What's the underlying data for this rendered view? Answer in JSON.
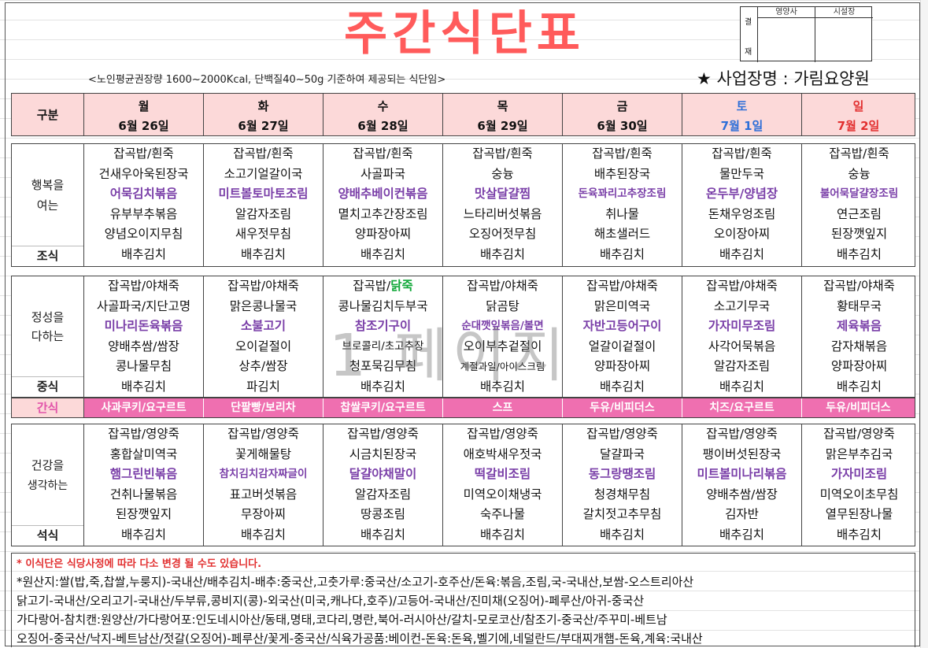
{
  "title": "주간식단표",
  "approval": {
    "side_label": [
      "결",
      "재"
    ],
    "col1": "영양사",
    "col2": "시설장"
  },
  "subnote": "<노인평균권장량 1600~2000Kcal, 단백질40~50g 기준하여 제공되는 식단임>",
  "business": "★ 사업장명 : 가림요양원",
  "header": {
    "category": "구분",
    "days": [
      {
        "day": "월",
        "date": "6월 26일"
      },
      {
        "day": "화",
        "date": "6월 27일"
      },
      {
        "day": "수",
        "date": "6월 28일"
      },
      {
        "day": "목",
        "date": "6월 29일"
      },
      {
        "day": "금",
        "date": "6월 30일"
      },
      {
        "day": "토",
        "date": "7월 1일"
      },
      {
        "day": "일",
        "date": "7월 2일"
      }
    ]
  },
  "colors": {
    "header_bg": "#fcd9d9",
    "title": "#ff5b5b",
    "highlight": "#7a3fa8",
    "snack_bg": "#ef6fb0",
    "saturday": "#2e6fd8",
    "sunday": "#e23030"
  },
  "breakfast": {
    "label_main": [
      "행복을",
      "여는"
    ],
    "label_meal": "조식",
    "cols": [
      [
        "잡곡밥/흰죽",
        "건새우아욱된장국",
        "어묵김치볶음",
        "유부부추볶음",
        "양념오이지무침",
        "배추김치"
      ],
      [
        "잡곡밥/흰죽",
        "소고기얼갈이국",
        "미트볼토마토조림",
        "알감자조림",
        "새우젓무침",
        "배추김치"
      ],
      [
        "잡곡밥/흰죽",
        "사골파국",
        "양배추베이컨볶음",
        "멸치고추간장조림",
        "양파장아찌",
        "배추김치"
      ],
      [
        "잡곡밥/흰죽",
        "숭늉",
        "맛살달걀찜",
        "느타리버섯볶음",
        "오징어젓무침",
        "배추김치"
      ],
      [
        "잡곡밥/흰죽",
        "배추된장국",
        "돈육꽈리고추장조림",
        "취나물",
        "해초샐러드",
        "배추김치"
      ],
      [
        "잡곡밥/흰죽",
        "물만두국",
        "온두부/양념장",
        "돈채우엉조림",
        "오이장아찌",
        "배추김치"
      ],
      [
        "잡곡밥/흰죽",
        "숭늉",
        "불어묵달걀장조림",
        "연근조림",
        "된장깻잎지",
        "배추김치"
      ]
    ]
  },
  "lunch": {
    "label_main": [
      "정성을",
      "다하는"
    ],
    "label_meal": "중식",
    "cols": [
      [
        "잡곡밥/야채죽",
        "사골파국/지단고명",
        "미나리돈육볶음",
        "양배추쌈/쌈장",
        "콩나물무침",
        "배추김치"
      ],
      [
        "잡곡밥/야채죽",
        "맑은콩나물국",
        "소불고기",
        "오이겉절이",
        "상추/쌈장",
        "파김치"
      ],
      [
        "잡곡밥/닭죽",
        "콩나물김치두부국",
        "참조기구이",
        "브로콜리/초고추장",
        "청포묵김무침",
        "배추김치"
      ],
      [
        "잡곡밥/야채죽",
        "닭곰탕",
        "순대깻잎볶음/볼면",
        "오이부추겉절이",
        "계절과일/아이스크림",
        "배추김치"
      ],
      [
        "잡곡밥/야채죽",
        "맑은미역국",
        "자반고등어구이",
        "얼갈이겉절이",
        "양파장아찌",
        "배추김치"
      ],
      [
        "잡곡밥/야채죽",
        "소고기무국",
        "가자미무조림",
        "사각어묵볶음",
        "알감자조림",
        "배추김치"
      ],
      [
        "잡곡밥/야채죽",
        "황태무국",
        "제육볶음",
        "감자채볶음",
        "양파장아찌",
        "배추김치"
      ]
    ]
  },
  "snack": {
    "label": "간식",
    "items": [
      "사과쿠키/요구르트",
      "단팥빵/보리차",
      "찹쌀쿠키/요구르트",
      "스프",
      "두유/비피더스",
      "치즈/요구르트",
      "두유/비피더스"
    ]
  },
  "dinner": {
    "label_main": [
      "건강을",
      "생각하는"
    ],
    "label_meal": "석식",
    "cols": [
      [
        "잡곡밥/영양죽",
        "홍합살미역국",
        "햄그린빈볶음",
        "건취나물볶음",
        "된장깻잎지",
        "배추김치"
      ],
      [
        "잡곡밥/영양죽",
        "꽃게해물탕",
        "참치김치감자짜글이",
        "표고버섯볶음",
        "무장아찌",
        "배추김치"
      ],
      [
        "잡곡밥/영양죽",
        "시금치된장국",
        "달걀야채말이",
        "알감자조림",
        "땅콩조림",
        "배추김치"
      ],
      [
        "잡곡밥/영양죽",
        "애호박새우젓국",
        "떡갈비조림",
        "미역오이채냉국",
        "숙주나물",
        "배추김치"
      ],
      [
        "잡곡밥/영양죽",
        "달걀파국",
        "동그랑땡조림",
        "청경채무침",
        "갈치젓고추무침",
        "배추김치"
      ],
      [
        "잡곡밥/영양죽",
        "팽이버섯된장국",
        "미트볼미나리볶음",
        "양배추쌈/쌈장",
        "김자반",
        "배추김치"
      ],
      [
        "잡곡밥/영양죽",
        "맑은부추김국",
        "가자미조림",
        "미역오이초무침",
        "열무된장나물",
        "배추김치"
      ]
    ]
  },
  "notes": {
    "warning": "* 이식단은  식당사정에 따라 다소 변경 될 수도 있습니다.",
    "lines": [
      "*원산지:쌀(밥,죽,찹쌀,누룽지)-국내산/배추김치-배추:중국산,고춧가루:중국산/소고기-호주산/돈육:볶음,조림,국-국내산,보쌈-오스트리아산",
      "닭고기-국내산/오리고기-국내산/두부류,콩비지(콩)-외국산(미국,캐나다,호주)/고등어-국내산/진미채(오징어)-페루산/아귀-중국산",
      "가다랑어-참치캔:원양산/가다랑어포:인도네시아산/동태,명태,코다리,명란,북어-러시아산/갈치-모로코산/참조기-중국산/주꾸미-베트남",
      "오징어-중국산/낙지-베트남산/젓갈(오징어)-페루산/꽃게-중국산/식육가공품:베이컨-돈육:돈육,벨기에,네덜란드/부대찌개햄-돈육,계육:국내산"
    ]
  },
  "watermark": "1 페이지"
}
